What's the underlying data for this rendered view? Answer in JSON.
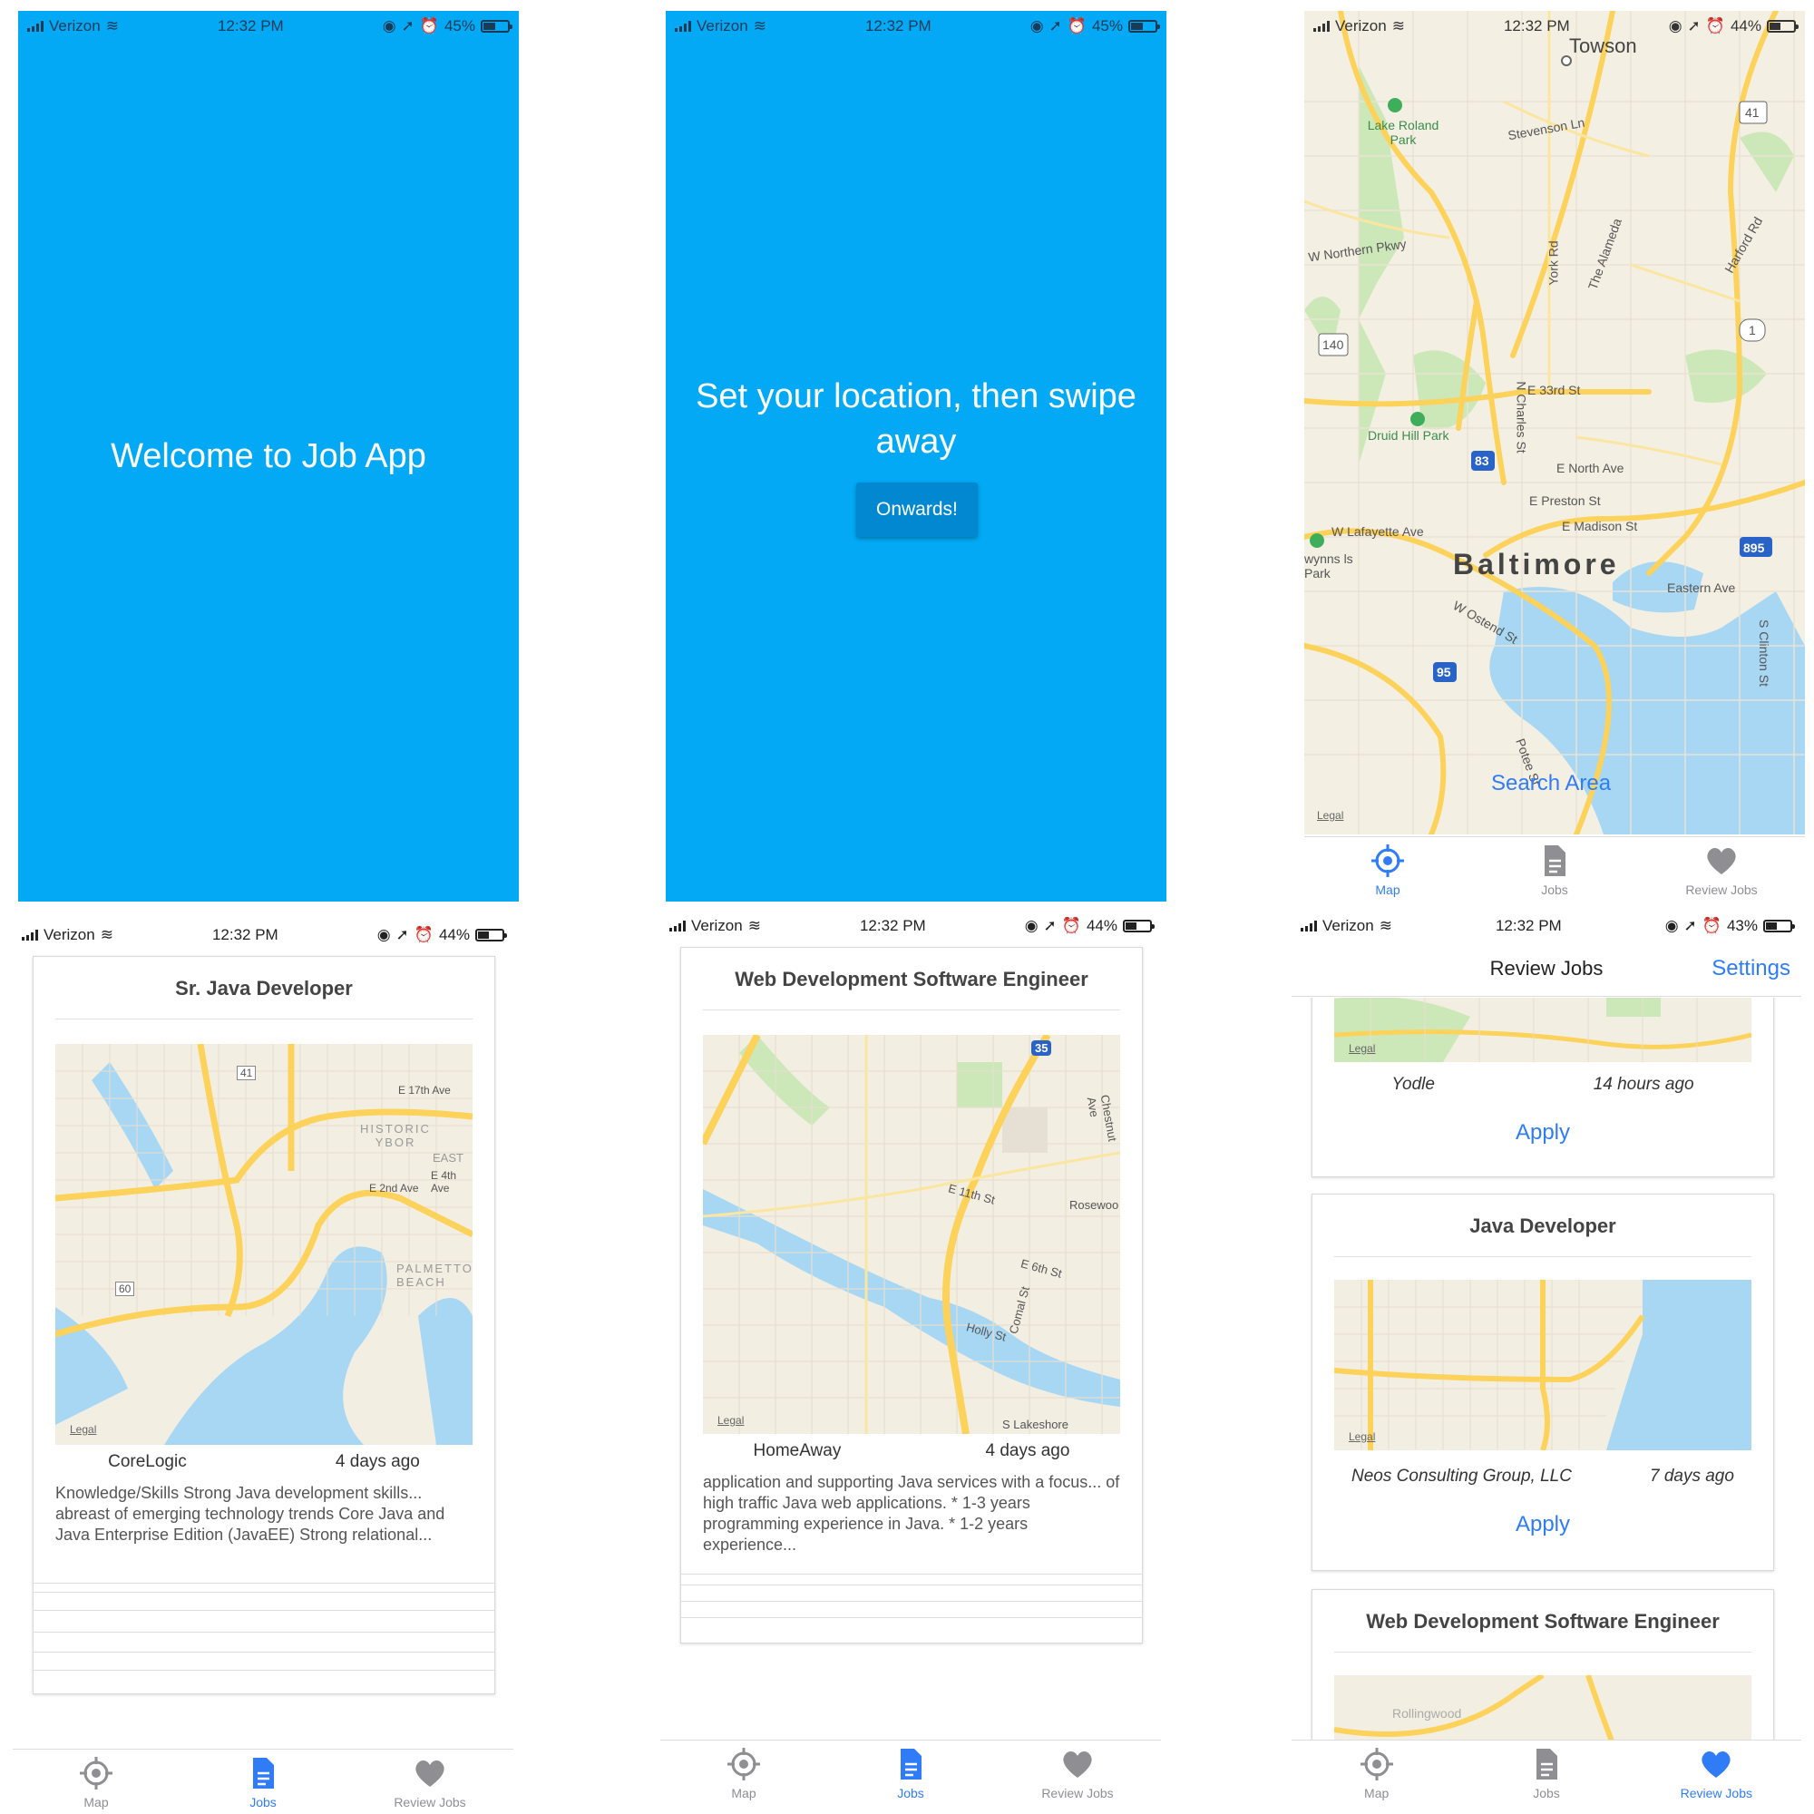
{
  "status": {
    "carrier": "Verizon",
    "time": "12:32 PM",
    "battery_s1": "45%",
    "battery_s2": "45%",
    "battery_s3": "44%",
    "battery_s4": "44%",
    "battery_s5": "44%",
    "battery_s6": "43%"
  },
  "welcome": {
    "title": "Welcome to Job App"
  },
  "onboard": {
    "title": "Set your location, then swipe away",
    "button": "Onwards!"
  },
  "map": {
    "search_area": "Search Area",
    "legal": "Legal",
    "labels": {
      "towson": "Towson",
      "lake_roland": "Lake Roland Park",
      "stevenson": "Stevenson Ln",
      "w_northern": "W Northern Pkwy",
      "york": "York Rd",
      "alameda": "The Alameda",
      "harford": "Harford Rd",
      "e33": "E 33rd St",
      "druid": "Druid Hill Park",
      "charles": "N Charles St",
      "north_ave": "E North Ave",
      "preston": "E Preston St",
      "lafayette": "W Lafayette Ave",
      "madison": "E Madison St",
      "baltimore": "Baltimore",
      "gwynns": "wynns ls Park",
      "eastern": "Eastern Ave",
      "ostend": "W Ostend St",
      "clinton": "S Clinton St",
      "potee": "Potee St"
    },
    "shields": {
      "i83": "83",
      "i895": "895",
      "i95": "95",
      "us1": "1",
      "r41": "41",
      "r140": "140"
    }
  },
  "tabs": {
    "map": "Map",
    "jobs": "Jobs",
    "review": "Review Jobs"
  },
  "job1": {
    "title": "Sr. Java Developer",
    "company": "CoreLogic",
    "age": "4 days ago",
    "description": "Knowledge/Skills Strong Java development skills... abreast of emerging technology trends Core Java and Java Enterprise Edition (JavaEE) Strong relational...",
    "map_labels": {
      "e17": "E 17th Ave",
      "hist": "HISTORIC YBOR",
      "east": "EAST",
      "e4": "E 4th Ave",
      "e2": "E 2nd Ave",
      "palm": "PALMETTO BEACH",
      "r41": "41",
      "r60": "60"
    }
  },
  "job2": {
    "title": "Web Development Software Engineer",
    "company": "HomeAway",
    "age": "4 days ago",
    "description": "application and supporting Java services with a focus... of high traffic Java web applications. * 1-3 years programming experience in Java. * 1-2 years experience...",
    "map_labels": {
      "e11": "E 11th St",
      "rosewood": "Rosewoo",
      "e6": "E 6th St",
      "comal": "Comal St",
      "holly": "Holly St",
      "chestnut": "Chestnut Ave",
      "lakeshore": "S Lakeshore",
      "i35": "35"
    }
  },
  "review": {
    "header": "Review Jobs",
    "settings": "Settings",
    "item1": {
      "company": "Yodle",
      "age": "14 hours ago",
      "apply": "Apply"
    },
    "item2": {
      "title": "Java Developer",
      "company": "Neos Consulting Group, LLC",
      "age": "7 days ago",
      "apply": "Apply"
    },
    "item3": {
      "title": "Web Development Software Engineer",
      "map_label": "Rollingwood"
    }
  }
}
